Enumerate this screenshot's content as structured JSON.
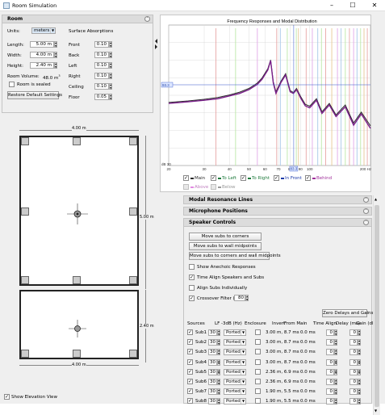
{
  "window": {
    "title": "Room Simulation"
  },
  "room": {
    "header": "Room",
    "units_label": "Units:",
    "units_value": "meters",
    "length_label": "Length:",
    "length_value": "5.00 m",
    "width_label": "Width:",
    "width_value": "4.00 m",
    "height_label": "Height:",
    "height_value": "2.40 m",
    "volume_label": "Room Volume:",
    "volume_value": "48.0 m",
    "volume_sup": "3",
    "sealed_label": "Room is sealed",
    "restore_label": "Restore Default Settings",
    "abs_header": "Surface Absorptions",
    "absorptions": [
      {
        "label": "Front",
        "value": "0.10"
      },
      {
        "label": "Back",
        "value": "0.10"
      },
      {
        "label": "Left",
        "value": "0.10"
      },
      {
        "label": "Right",
        "value": "0.10"
      },
      {
        "label": "Ceiling",
        "value": "0.10"
      },
      {
        "label": "Floor",
        "value": "0.05"
      }
    ]
  },
  "floorplan": {
    "width_label": "4.00 m",
    "length_label": "5.00 m",
    "elev_width_label": "4.00 m",
    "elev_height_label": "2.40 m"
  },
  "show_elevation_label": "Show Elevation View",
  "chart_data": {
    "type": "line",
    "title": "Frequency Responses and Modal Distribution",
    "x_scale": "log",
    "xlim": [
      20,
      200
    ],
    "x_ticks": [
      "20",
      "30",
      "40",
      "50",
      "60",
      "70",
      "80",
      "90",
      "100",
      "200 Hz"
    ],
    "y_label_top": "93.3",
    "y_label_bottom": "dB 30",
    "x_marker": "83.3",
    "grid": true,
    "series": [
      {
        "name": "Main",
        "color": "#2a2a2a",
        "x": [
          20,
          25,
          30,
          35,
          40,
          45,
          50,
          55,
          58,
          62,
          64,
          66,
          68,
          72,
          76,
          80,
          83,
          86,
          90,
          95,
          100,
          108,
          115,
          125,
          135,
          150,
          165,
          180,
          200
        ],
        "y": [
          -9.8,
          -9.3,
          -8.8,
          -8.2,
          -7.4,
          -6.5,
          -5.3,
          -3.6,
          -2.0,
          1.0,
          3.8,
          -3.2,
          -6.4,
          -3.0,
          -0.6,
          -6.0,
          -6.6,
          -5.3,
          -7.8,
          -10.4,
          -11.0,
          -8.6,
          -12.8,
          -10.1,
          -13.8,
          -10.6,
          -16.4,
          -12.9,
          -17.3
        ]
      },
      {
        "name": "Behind",
        "color": "#7a1f8a",
        "x": [
          20,
          25,
          30,
          35,
          40,
          45,
          50,
          55,
          58,
          62,
          64,
          66,
          68,
          72,
          76,
          80,
          83,
          86,
          90,
          95,
          100,
          108,
          115,
          125,
          135,
          150,
          165,
          180,
          200
        ],
        "y": [
          -10.1,
          -9.6,
          -9.1,
          -8.6,
          -7.7,
          -6.9,
          -5.7,
          -4.0,
          -2.4,
          0.6,
          3.6,
          -3.6,
          -6.9,
          -3.4,
          -1.0,
          -6.4,
          -6.9,
          -5.7,
          -8.3,
          -10.9,
          -11.5,
          -9.1,
          -13.3,
          -10.6,
          -14.3,
          -11.2,
          -17.1,
          -13.5,
          -18.1
        ]
      }
    ],
    "mode_lines": [
      {
        "f": 34.3,
        "c": "#e8a6a6"
      },
      {
        "f": 42.9,
        "c": "#bde8a8"
      },
      {
        "f": 55.0,
        "c": "#e2a8e8"
      },
      {
        "f": 68.6,
        "c": "#e8a6a6"
      },
      {
        "f": 71.5,
        "c": "#a8c8e8"
      },
      {
        "f": 77.4,
        "c": "#bde8a8"
      },
      {
        "f": 85.8,
        "c": "#bde8a8"
      },
      {
        "f": 87.9,
        "c": "#e8c896"
      },
      {
        "f": 96.0,
        "c": "#e8a6a6"
      },
      {
        "f": 103.0,
        "c": "#e2a8e8"
      },
      {
        "f": 109.6,
        "c": "#a8c8e8"
      },
      {
        "f": 114.3,
        "c": "#bde8a8"
      },
      {
        "f": 120.0,
        "c": "#e8a6a6"
      },
      {
        "f": 128.6,
        "c": "#e8c896"
      },
      {
        "f": 137.2,
        "c": "#e2a8e8"
      },
      {
        "f": 143.0,
        "c": "#a8c8e8"
      },
      {
        "f": 150.1,
        "c": "#bde8a8"
      },
      {
        "f": 157.3,
        "c": "#e8a6a6"
      },
      {
        "f": 165.0,
        "c": "#e2a8e8"
      },
      {
        "f": 171.5,
        "c": "#a8c8e8"
      },
      {
        "f": 178.7,
        "c": "#bde8a8"
      },
      {
        "f": 185.8,
        "c": "#e8c896"
      },
      {
        "f": 192.9,
        "c": "#e8a6a6"
      }
    ],
    "legend": [
      {
        "label": "Main",
        "color": "#2a2a2a",
        "checked": true
      },
      {
        "label": "To Left",
        "color": "#1e7a3c",
        "checked": true
      },
      {
        "label": "To Right",
        "color": "#1e7a3c",
        "checked": true
      },
      {
        "label": "In Front",
        "color": "#1c3aa8",
        "checked": true
      },
      {
        "label": "Behind",
        "color": "#a0309a",
        "checked": true
      },
      {
        "label": "Above",
        "color": "#e28ae2",
        "checked": false
      },
      {
        "label": "Below",
        "color": "#9a9a9a",
        "checked": false
      }
    ]
  },
  "accordion": {
    "modal": "Modal Resonance Lines",
    "mic": "Microphone Positions",
    "speaker": "Speaker Controls"
  },
  "speaker": {
    "move_corners": "Move subs to corners",
    "move_midpoints": "Move subs to wall midpoints",
    "move_both": "Move subs to corners and wall midpoints",
    "anechoic": "Show Anechoic Responses",
    "time_align": "Time Align Speakers and Subs",
    "align_subs": "Align Subs Individually",
    "crossover": "Crossover Filter (Hz)",
    "crossover_value": "80",
    "zero_delays": "Zero Delays and Gains",
    "cols": [
      "Sources",
      "LF -3dB (Hz)",
      "Enclosure",
      "Invert",
      "From Main",
      "Time Align",
      "Delay (ms)",
      "Gain (dB)"
    ],
    "rows": [
      {
        "name": "Sub1",
        "lf": "30",
        "enc": "Ported",
        "from": "3.00 m, 8.7 ms",
        "ta": "0.0 ms",
        "delay": "0",
        "gain": "0"
      },
      {
        "name": "Sub2",
        "lf": "30",
        "enc": "Ported",
        "from": "3.00 m, 8.7 ms",
        "ta": "0.0 ms",
        "delay": "0",
        "gain": "0"
      },
      {
        "name": "Sub3",
        "lf": "30",
        "enc": "Ported",
        "from": "3.00 m, 8.7 ms",
        "ta": "0.0 ms",
        "delay": "0",
        "gain": "0"
      },
      {
        "name": "Sub4",
        "lf": "30",
        "enc": "Ported",
        "from": "3.00 m, 8.7 ms",
        "ta": "0.0 ms",
        "delay": "0",
        "gain": "0"
      },
      {
        "name": "Sub5",
        "lf": "30",
        "enc": "Ported",
        "from": "2.36 m, 6.9 ms",
        "ta": "0.0 ms",
        "delay": "0",
        "gain": "0"
      },
      {
        "name": "Sub6",
        "lf": "30",
        "enc": "Ported",
        "from": "2.36 m, 6.9 ms",
        "ta": "0.0 ms",
        "delay": "0",
        "gain": "0"
      },
      {
        "name": "Sub7",
        "lf": "30",
        "enc": "Ported",
        "from": "1.90 m, 5.5 ms",
        "ta": "0.0 ms",
        "delay": "0",
        "gain": "0"
      },
      {
        "name": "Sub8",
        "lf": "30",
        "enc": "Ported",
        "from": "1.90 m, 5.5 ms",
        "ta": "0.0 ms",
        "delay": "0",
        "gain": "0"
      }
    ]
  }
}
